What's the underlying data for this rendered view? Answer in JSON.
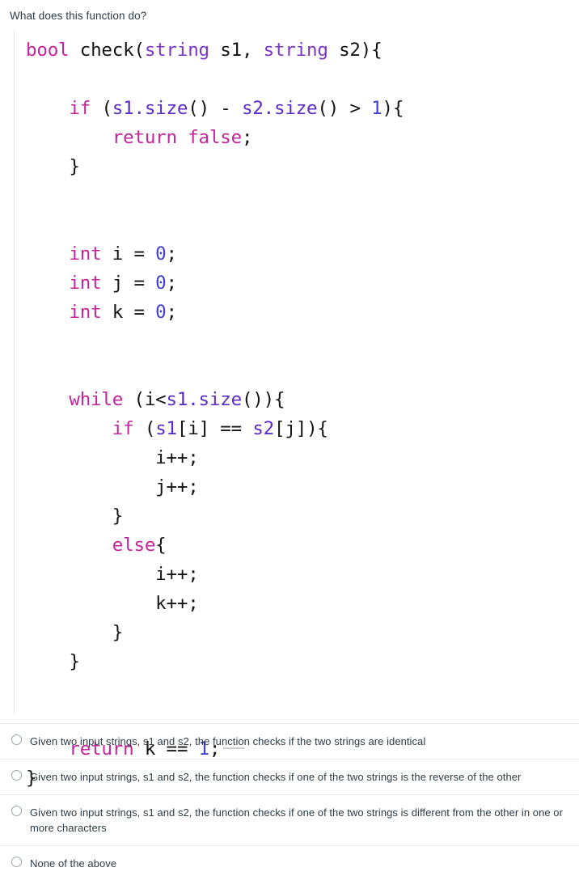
{
  "question": {
    "prompt": "What does this function do?"
  },
  "code": {
    "language": "cpp",
    "lines": [
      [
        {
          "t": "bool",
          "c": "kw"
        },
        {
          "t": " check(",
          "c": "pln"
        },
        {
          "t": "string",
          "c": "typ"
        },
        {
          "t": " s1, ",
          "c": "pln"
        },
        {
          "t": "string",
          "c": "typ"
        },
        {
          "t": " s2){",
          "c": "pln"
        }
      ],
      [],
      [
        {
          "t": "    ",
          "c": "pln"
        },
        {
          "t": "if",
          "c": "kw"
        },
        {
          "t": " (",
          "c": "pln"
        },
        {
          "t": "s1.size",
          "c": "var"
        },
        {
          "t": "() - ",
          "c": "pln"
        },
        {
          "t": "s2.size",
          "c": "var"
        },
        {
          "t": "() > ",
          "c": "pln"
        },
        {
          "t": "1",
          "c": "num"
        },
        {
          "t": "){",
          "c": "pln"
        }
      ],
      [
        {
          "t": "        ",
          "c": "pln"
        },
        {
          "t": "return false",
          "c": "kw"
        },
        {
          "t": ";",
          "c": "pln"
        }
      ],
      [
        {
          "t": "    }",
          "c": "pln"
        }
      ],
      [],
      [],
      [
        {
          "t": "    ",
          "c": "pln"
        },
        {
          "t": "int",
          "c": "kw"
        },
        {
          "t": " i = ",
          "c": "pln"
        },
        {
          "t": "0",
          "c": "num"
        },
        {
          "t": ";",
          "c": "pln"
        }
      ],
      [
        {
          "t": "    ",
          "c": "pln"
        },
        {
          "t": "int",
          "c": "kw"
        },
        {
          "t": " j = ",
          "c": "pln"
        },
        {
          "t": "0",
          "c": "num"
        },
        {
          "t": ";",
          "c": "pln"
        }
      ],
      [
        {
          "t": "    ",
          "c": "pln"
        },
        {
          "t": "int",
          "c": "kw"
        },
        {
          "t": " k = ",
          "c": "pln"
        },
        {
          "t": "0",
          "c": "num"
        },
        {
          "t": ";",
          "c": "pln"
        }
      ],
      [],
      [],
      [
        {
          "t": "    ",
          "c": "pln"
        },
        {
          "t": "while",
          "c": "kw"
        },
        {
          "t": " (i<",
          "c": "pln"
        },
        {
          "t": "s1.size",
          "c": "var"
        },
        {
          "t": "()){",
          "c": "pln"
        }
      ],
      [
        {
          "t": "        ",
          "c": "pln"
        },
        {
          "t": "if",
          "c": "kw"
        },
        {
          "t": " (",
          "c": "pln"
        },
        {
          "t": "s1",
          "c": "var"
        },
        {
          "t": "[i] == ",
          "c": "pln"
        },
        {
          "t": "s2",
          "c": "var"
        },
        {
          "t": "[j]){",
          "c": "pln"
        }
      ],
      [
        {
          "t": "            i++;",
          "c": "pln"
        }
      ],
      [
        {
          "t": "            j++;",
          "c": "pln"
        }
      ],
      [
        {
          "t": "        }",
          "c": "pln"
        }
      ],
      [
        {
          "t": "        ",
          "c": "pln"
        },
        {
          "t": "else",
          "c": "kw"
        },
        {
          "t": "{",
          "c": "pln"
        }
      ],
      [
        {
          "t": "            i++;",
          "c": "pln"
        }
      ],
      [
        {
          "t": "            k++;",
          "c": "pln"
        }
      ],
      [
        {
          "t": "        }",
          "c": "pln"
        }
      ],
      [
        {
          "t": "    }",
          "c": "pln"
        }
      ],
      [],
      [],
      [
        {
          "t": "    ",
          "c": "pln"
        },
        {
          "t": "return",
          "c": "kw"
        },
        {
          "t": " k == ",
          "c": "pln"
        },
        {
          "t": "1",
          "c": "num"
        },
        {
          "t": ";",
          "c": "pln"
        },
        {
          "t": "",
          "c": "caret"
        }
      ],
      [
        {
          "t": "}",
          "c": "pln"
        }
      ]
    ]
  },
  "answers": {
    "options": [
      {
        "label": "Given two input strings, s1 and s2, the function checks if the two strings are identical",
        "selected": false
      },
      {
        "label": "Given two input strings, s1 and s2, the function checks if one of the two strings is the reverse of the other",
        "selected": false
      },
      {
        "label": "Given two input strings, s1 and s2, the function checks if one of the two strings is different from the other in one or more characters",
        "selected": false
      },
      {
        "label": "None of the above",
        "selected": false
      }
    ]
  },
  "colors": {
    "text": "#2d3b45",
    "keyword": "#c2259c",
    "type": "#7d35c4",
    "variable": "#5b2bc7",
    "number": "#3f3fd0",
    "plain": "#141414",
    "divider": "#e8eaec",
    "code_border": "#e3e5e7",
    "radio_border": "#9ba5ad"
  }
}
